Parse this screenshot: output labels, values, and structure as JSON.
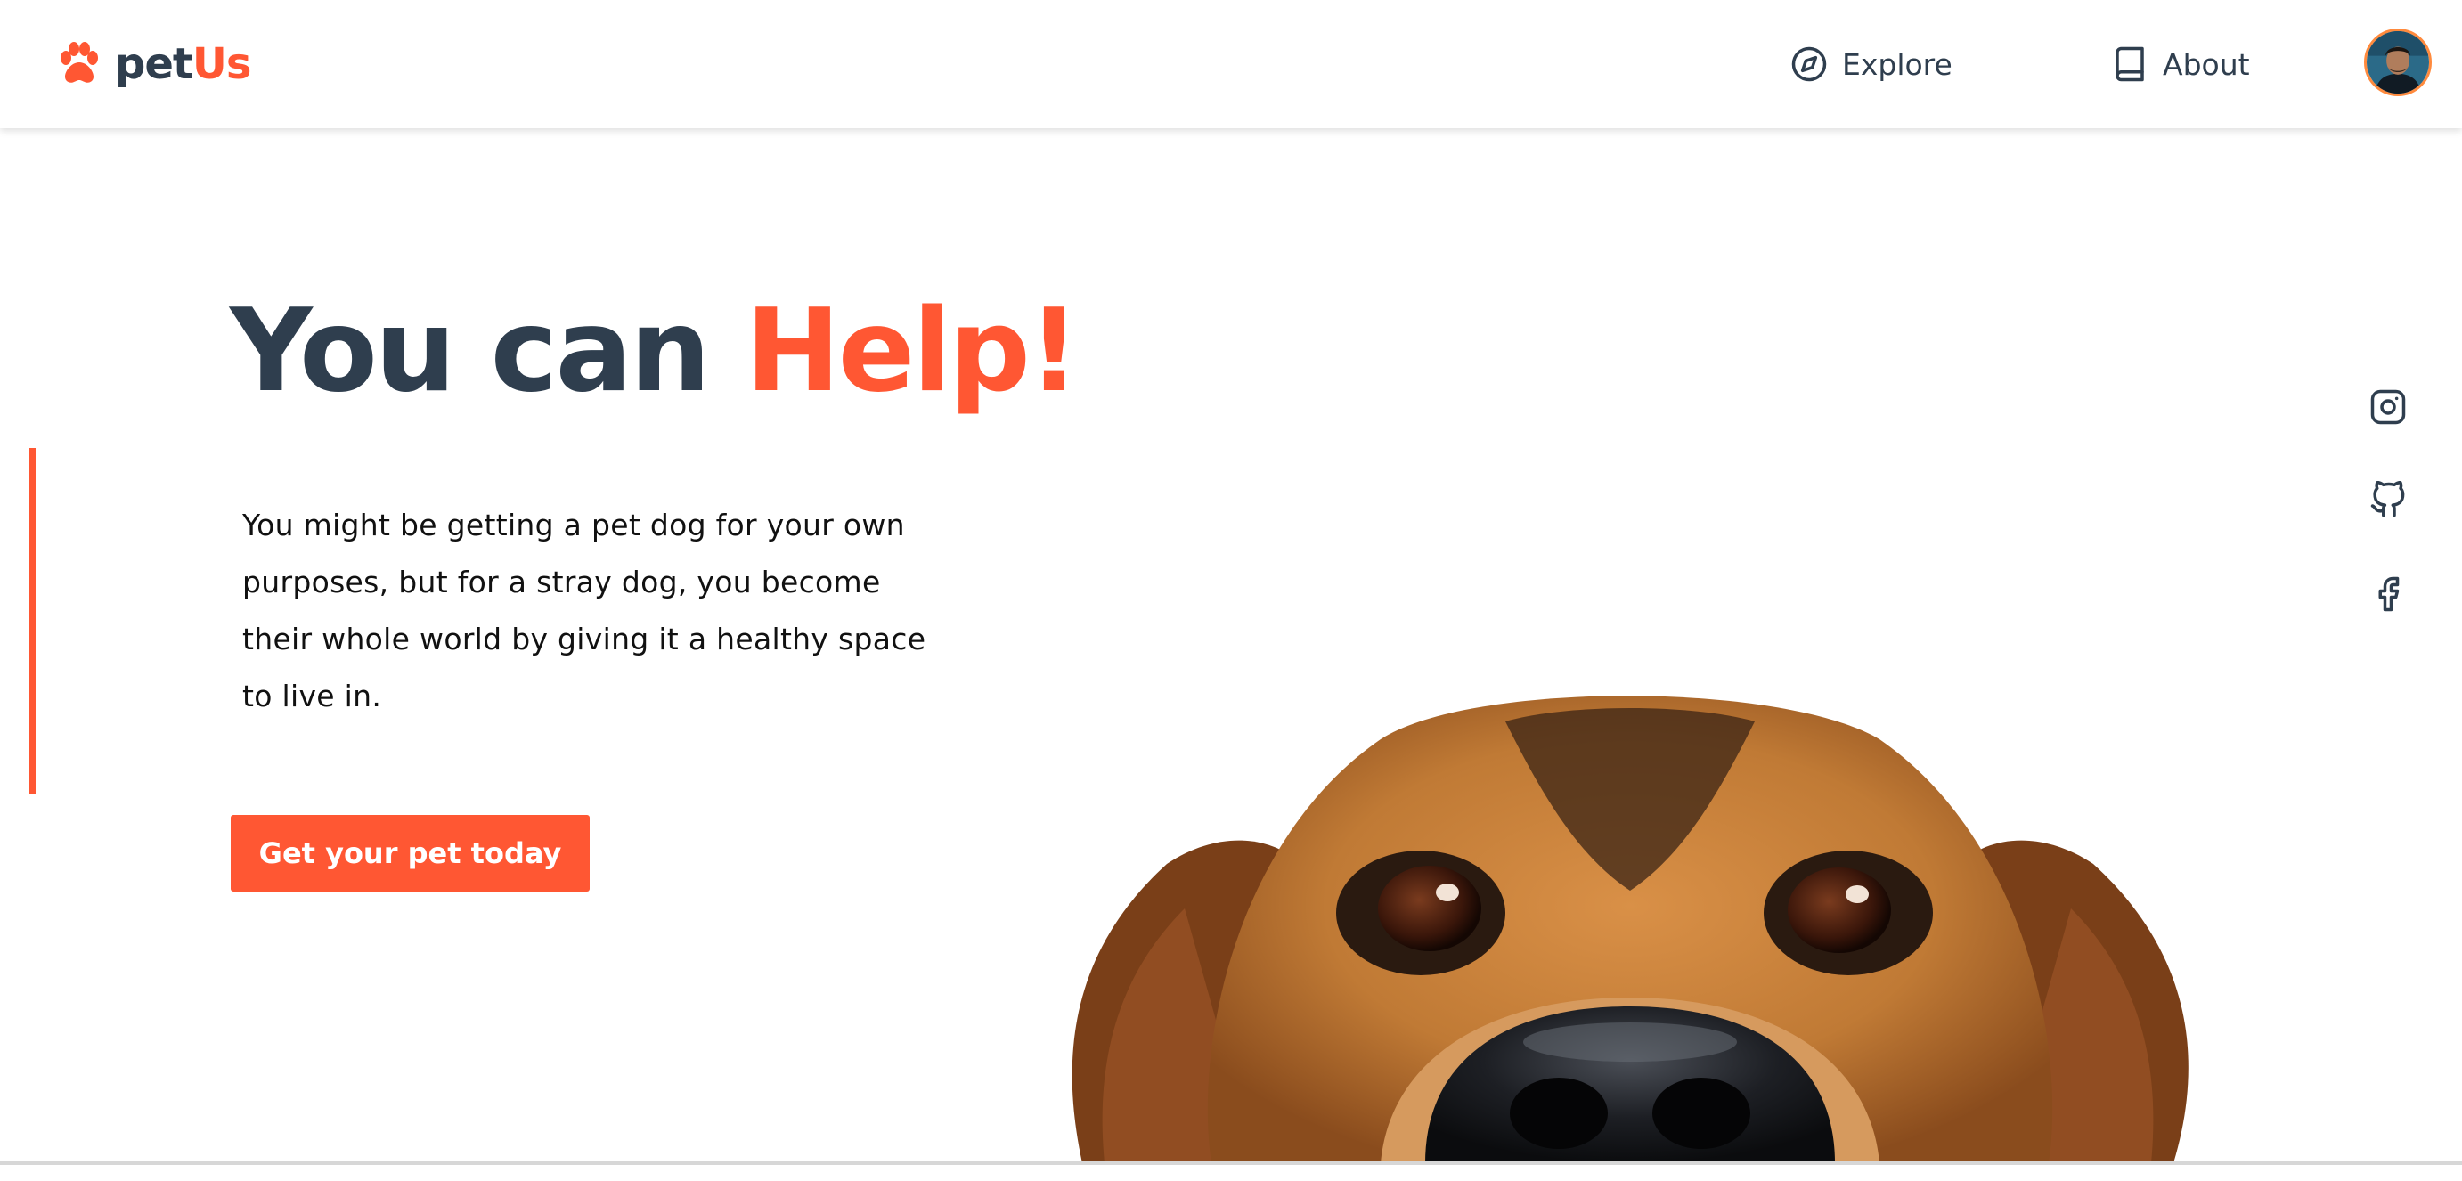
{
  "header": {
    "brand_first": "pet",
    "brand_second": "Us",
    "nav": [
      {
        "label": "Explore",
        "icon": "compass-icon"
      },
      {
        "label": "About",
        "icon": "book-icon"
      }
    ],
    "avatar_icon": "user-avatar"
  },
  "hero": {
    "headline_part1": "You can ",
    "headline_part2": "Help!",
    "description": "You might be getting a pet dog for your own purposes, but for a stray dog, you become their whole world by giving it a healthy space to live in.",
    "cta_label": "Get your pet today",
    "image": "dog-peeking-photo"
  },
  "social": [
    "instagram-icon",
    "github-icon",
    "facebook-icon"
  ],
  "colors": {
    "accent": "#ff5733",
    "text_dark": "#2f3e4e",
    "background": "#ffffff"
  }
}
